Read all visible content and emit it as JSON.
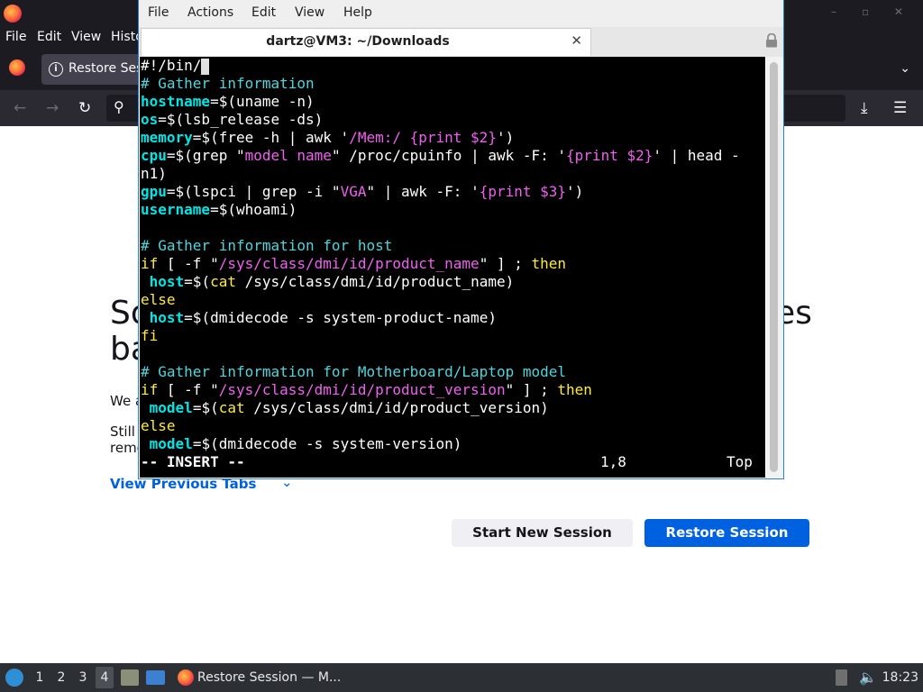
{
  "firefox": {
    "menu": [
      "File",
      "Edit",
      "View",
      "Histo"
    ],
    "tab_label": "Restore Ses",
    "page": {
      "title_left_1": "So",
      "title_left_2": "ba",
      "title_right": "es",
      "p1": "We a",
      "p2_line1": "Still",
      "p2_line2": "reme",
      "view_previous": "View Previous Tabs",
      "start_new_session": "Start New Session",
      "restore_session": "Restore Session"
    }
  },
  "terminal": {
    "menu": [
      "File",
      "Actions",
      "Edit",
      "View",
      "Help"
    ],
    "tab_title": "dartz@VM3: ~/Downloads",
    "code_lines": [
      [
        {
          "t": "#!/bin/",
          "c": ""
        }
      ],
      [
        {
          "t": "# Gather information",
          "c": "c"
        }
      ],
      [
        {
          "t": "hostname",
          "c": "k"
        },
        {
          "t": "=$(uname -n)",
          "c": ""
        }
      ],
      [
        {
          "t": "os",
          "c": "k"
        },
        {
          "t": "=$(lsb_release -ds)",
          "c": ""
        }
      ],
      [
        {
          "t": "memory",
          "c": "k"
        },
        {
          "t": "=$(free -h | awk '",
          "c": ""
        },
        {
          "t": "/Mem:/ {print $2}",
          "c": "s"
        },
        {
          "t": "')",
          "c": ""
        }
      ],
      [
        {
          "t": "cpu",
          "c": "k"
        },
        {
          "t": "=$(grep \"",
          "c": ""
        },
        {
          "t": "model name",
          "c": "s"
        },
        {
          "t": "\" /proc/cpuinfo | awk -F: '",
          "c": ""
        },
        {
          "t": "{print $2}",
          "c": "s"
        },
        {
          "t": "' | head -",
          "c": ""
        }
      ],
      [
        {
          "t": "n1)",
          "c": ""
        }
      ],
      [
        {
          "t": "gpu",
          "c": "k"
        },
        {
          "t": "=$(lspci | grep -i \"",
          "c": ""
        },
        {
          "t": "VGA",
          "c": "s"
        },
        {
          "t": "\" | awk -F: '",
          "c": ""
        },
        {
          "t": "{print $3}",
          "c": "s"
        },
        {
          "t": "')",
          "c": ""
        }
      ],
      [
        {
          "t": "username",
          "c": "k"
        },
        {
          "t": "=$(whoami)",
          "c": ""
        }
      ],
      [],
      [
        {
          "t": "# Gather information for host",
          "c": "c"
        }
      ],
      [
        {
          "t": "if",
          "c": "y"
        },
        {
          "t": " [ -f \"",
          "c": ""
        },
        {
          "t": "/sys/class/dmi/id/product_name",
          "c": "s"
        },
        {
          "t": "\" ] ; ",
          "c": ""
        },
        {
          "t": "then",
          "c": "y"
        }
      ],
      [
        {
          "t": " ",
          "c": ""
        },
        {
          "t": "host",
          "c": "k"
        },
        {
          "t": "=$(",
          "c": ""
        },
        {
          "t": "cat",
          "c": "y"
        },
        {
          "t": " /sys/class/dmi/id/product_name)",
          "c": ""
        }
      ],
      [
        {
          "t": "else",
          "c": "y"
        }
      ],
      [
        {
          "t": " ",
          "c": ""
        },
        {
          "t": "host",
          "c": "k"
        },
        {
          "t": "=$(dmidecode -s system-product-name)",
          "c": ""
        }
      ],
      [
        {
          "t": "fi",
          "c": "y"
        }
      ],
      [],
      [
        {
          "t": "# Gather information for Motherboard/Laptop model",
          "c": "c"
        }
      ],
      [
        {
          "t": "if",
          "c": "y"
        },
        {
          "t": " [ -f \"",
          "c": ""
        },
        {
          "t": "/sys/class/dmi/id/product_version",
          "c": "s"
        },
        {
          "t": "\" ] ; ",
          "c": ""
        },
        {
          "t": "then",
          "c": "y"
        }
      ],
      [
        {
          "t": " ",
          "c": ""
        },
        {
          "t": "model",
          "c": "k"
        },
        {
          "t": "=$(",
          "c": ""
        },
        {
          "t": "cat",
          "c": "y"
        },
        {
          "t": " /sys/class/dmi/id/product_version)",
          "c": ""
        }
      ],
      [
        {
          "t": "else",
          "c": "y"
        }
      ],
      [
        {
          "t": " ",
          "c": ""
        },
        {
          "t": "model",
          "c": "k"
        },
        {
          "t": "=$(dmidecode -s system-version)",
          "c": ""
        }
      ]
    ],
    "status_mode": "-- INSERT --",
    "status_position": "1,8",
    "status_scroll": "Top"
  },
  "taskbar": {
    "workspaces": [
      "1",
      "2",
      "3",
      "4"
    ],
    "active_workspace": "4",
    "task_label": "Restore Session — M...",
    "clock": "18:23"
  }
}
